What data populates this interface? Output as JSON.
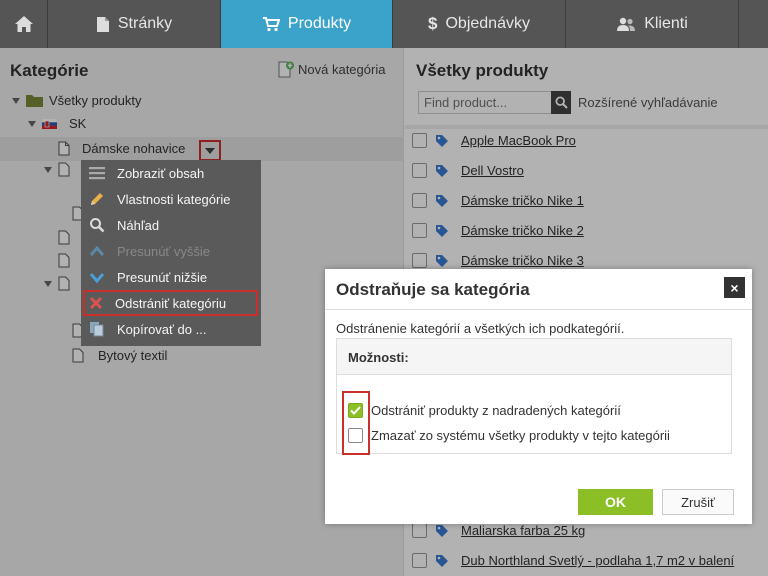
{
  "nav": {
    "home_icon": "home-icon",
    "tabs": [
      {
        "label": "Stránky",
        "icon": "page-icon"
      },
      {
        "label": "Produkty",
        "icon": "cart-icon",
        "active": true
      },
      {
        "label": "Objednávky",
        "icon": "dollar-icon"
      },
      {
        "label": "Klienti",
        "icon": "users-icon"
      }
    ]
  },
  "left": {
    "title": "Kategórie",
    "new_category": "Nová kategória",
    "tree": {
      "root": "Všetky produkty",
      "sk": "SK",
      "selected": "Dámske nohavice",
      "last": "Bytový textil"
    },
    "context_menu": [
      {
        "label": "Zobraziť obsah",
        "icon": "list-icon"
      },
      {
        "label": "Vlastnosti kategórie",
        "icon": "pencil-icon"
      },
      {
        "label": "Náhľad",
        "icon": "search-icon"
      },
      {
        "label": "Presunúť vyššie",
        "icon": "chevron-up-icon",
        "disabled": true
      },
      {
        "label": "Presunúť nižšie",
        "icon": "chevron-down-icon"
      },
      {
        "label": "Odstrániť kategóriu",
        "icon": "delete-x-icon"
      },
      {
        "label": "Kopírovať do ...",
        "icon": "copy-icon"
      }
    ]
  },
  "right": {
    "title": "Všetky produkty",
    "search_placeholder": "Find product...",
    "advanced_search": "Rozšírené vyhľadávanie",
    "products": [
      "Apple MacBook Pro",
      "Dell Vostro",
      "Dámske tričko Nike 1",
      "Dámske tričko Nike 2",
      "Dámske tričko Nike 3"
    ],
    "products_bottom": [
      "Maliarska farba 25 kg",
      "Dub Northland Svetlý - podlaha 1,7 m2 v balení"
    ]
  },
  "dialog": {
    "title": "Odstraňuje sa kategória",
    "close": "×",
    "description": "Odstránenie kategórií a všetkých ich podkategórií.",
    "options_header": "Možnosti:",
    "options": [
      {
        "label": "Odstrániť produkty z nadradených kategórií",
        "checked": true
      },
      {
        "label": "Zmazať zo systému všetky produkty v tejto kategórii",
        "checked": false
      }
    ],
    "ok": "OK",
    "cancel": "Zrušiť"
  },
  "colors": {
    "nav_bg": "#4a4a4a",
    "nav_active": "#3ba3c9",
    "ok_green": "#8cbf26",
    "highlight_red": "#c9302c",
    "tag_blue": "#3a7bd5"
  }
}
